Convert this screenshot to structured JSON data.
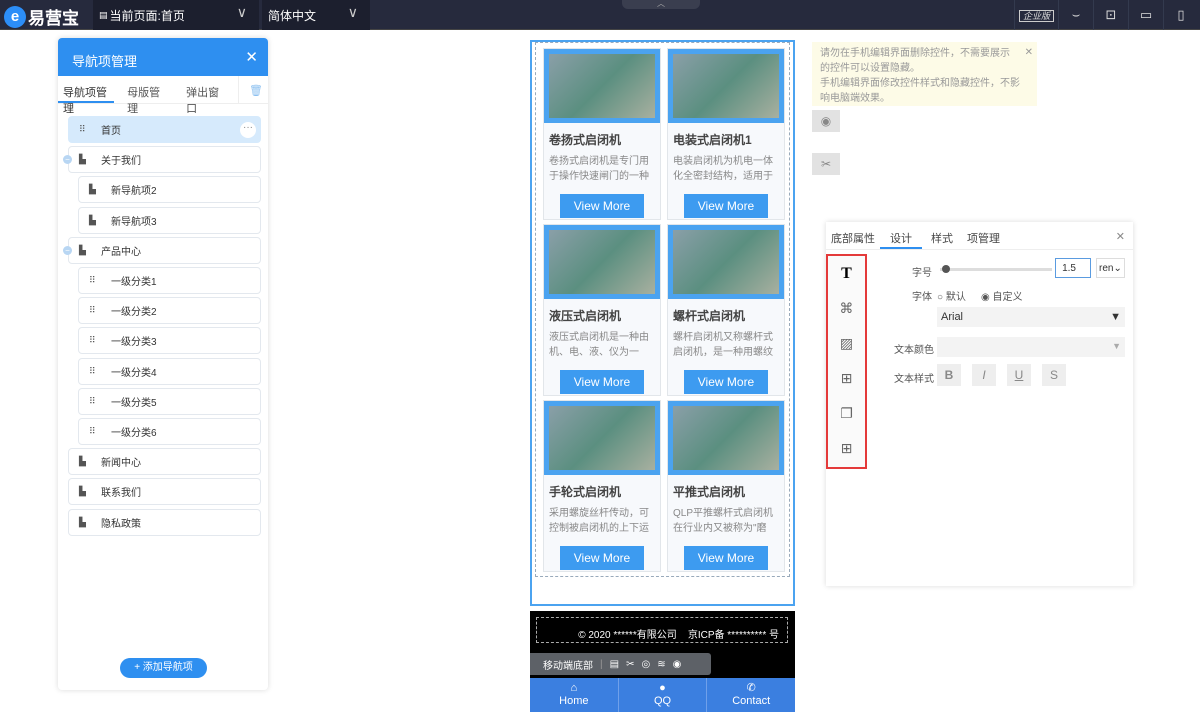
{
  "topbar": {
    "logo": "易营宝",
    "page_select": "当前页面:首页",
    "lang_select": "简体中文",
    "edition_badge": "企业版"
  },
  "nav_panel": {
    "title": "导航项管理",
    "tabs": [
      "导航项管理",
      "母版管理",
      "弹出窗口"
    ],
    "items": [
      {
        "label": "首页"
      },
      {
        "label": "关于我们"
      },
      {
        "label": "新导航项2"
      },
      {
        "label": "新导航项3"
      },
      {
        "label": "产品中心"
      },
      {
        "label": "一级分类1"
      },
      {
        "label": "一级分类2"
      },
      {
        "label": "一级分类3"
      },
      {
        "label": "一级分类4"
      },
      {
        "label": "一级分类5"
      },
      {
        "label": "一级分类6"
      },
      {
        "label": "新闻中心"
      },
      {
        "label": "联系我们"
      },
      {
        "label": "隐私政策"
      }
    ],
    "add_button": "+ 添加导航项"
  },
  "products": [
    {
      "title": "卷扬式启闭机",
      "desc": "卷扬式启闭机是专门用于操作快速闸门的一种启...",
      "button": "View More"
    },
    {
      "title": "电装式启闭机1",
      "desc": "电装启闭机为机电一体化全密封结构，适用于户...",
      "button": "View More"
    },
    {
      "title": "液压式启闭机",
      "desc": "液压式启闭机是一种由机、电、液、仪为一体...",
      "button": "View More"
    },
    {
      "title": "螺杆式启闭机",
      "desc": "螺杆启闭机又称螺杆式启闭机，是一种用螺纹杆...",
      "button": "View More"
    },
    {
      "title": "手轮式启闭机",
      "desc": "采用螺旋丝杆传动，可控制被启闭机的上下运动...",
      "button": "View More"
    },
    {
      "title": "平推式启闭机",
      "desc": "QLP平推螺杆式启闭机在行业内又被称为\"磨盘...",
      "button": "View More"
    }
  ],
  "footer": {
    "copyright": "© 2020 ******有限公司",
    "icp": "京ICP备 ********** 号",
    "toolbar_label": "移动端底部"
  },
  "bottom_nav": [
    "Home",
    "QQ",
    "Contact"
  ],
  "tip": {
    "line1": "请勿在手机编辑界面删除控件，不需要展示的控件可以设置隐藏。",
    "line2": "手机编辑界面修改控件样式和隐藏控件，不影响电脑端效果。"
  },
  "props": {
    "tabs": [
      "底部属性",
      "设计",
      "样式",
      "项管理"
    ],
    "font_size_label": "字号",
    "font_size_value": "1.5",
    "unit": "ren",
    "font_label": "字体",
    "font_default": "默认",
    "font_custom": "自定义",
    "font_value": "Arial",
    "color_label": "文本颜色",
    "style_label": "文本样式",
    "styles": [
      "B",
      "I",
      "U",
      "S"
    ]
  }
}
